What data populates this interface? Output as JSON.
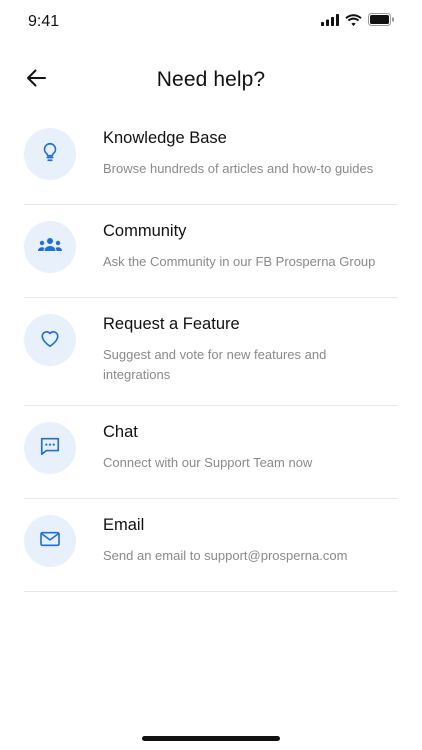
{
  "status_bar": {
    "time": "9:41"
  },
  "header": {
    "title": "Need help?"
  },
  "items": [
    {
      "title": "Knowledge Base",
      "description": "Browse hundreds of articles and how-to guides",
      "icon": "lightbulb-icon"
    },
    {
      "title": "Community",
      "description": "Ask the Community in our FB Prosperna Group",
      "icon": "group-icon"
    },
    {
      "title": "Request a Feature",
      "description": "Suggest and vote for new features and integrations",
      "icon": "heart-icon"
    },
    {
      "title": "Chat",
      "description": "Connect with our Support Team now",
      "icon": "chat-bubble-icon"
    },
    {
      "title": "Email",
      "description": "Send an email to support@prosperna.com",
      "icon": "envelope-icon"
    }
  ],
  "colors": {
    "accent": "#1f6fd6",
    "icon_bg": "#e8f0fc",
    "divider": "#e6e6e6",
    "desc_text": "#8a8a8a"
  }
}
